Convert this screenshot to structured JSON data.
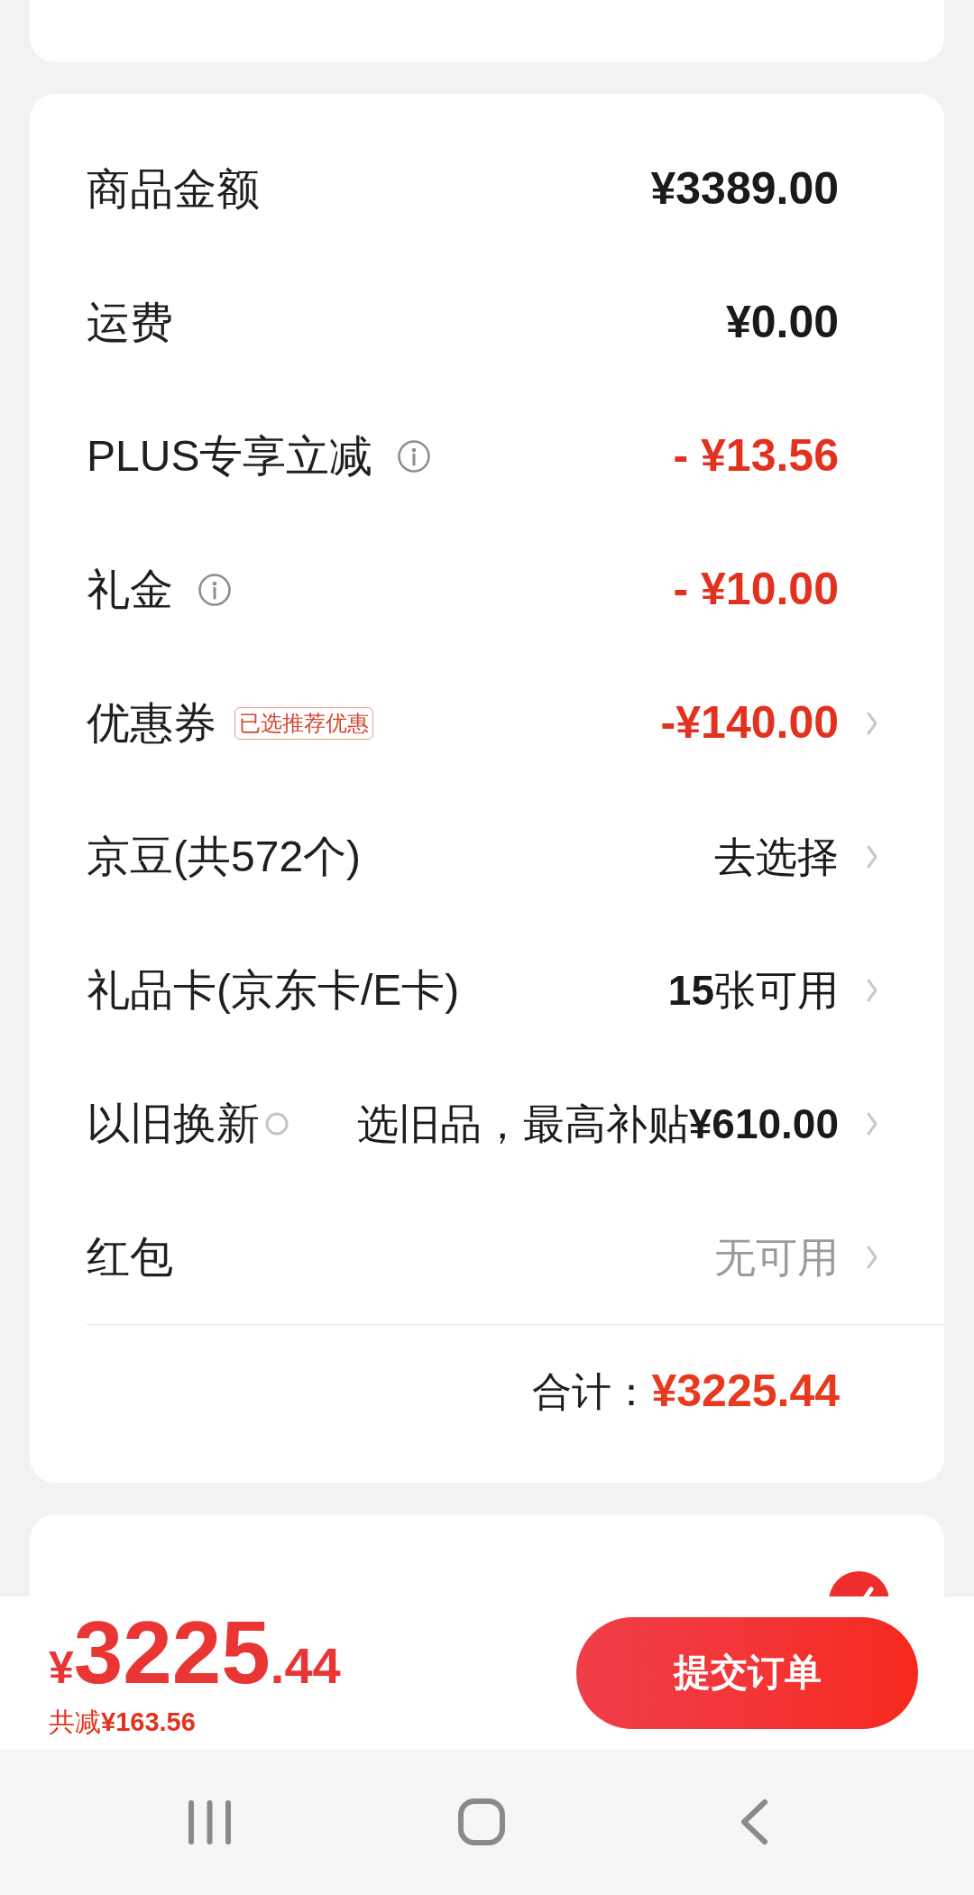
{
  "summary": {
    "rows": [
      {
        "kind": "amount",
        "label": "商品金额",
        "info": false,
        "chevron": false,
        "value": "¥3389.00"
      },
      {
        "kind": "amount",
        "label": "运费",
        "info": false,
        "chevron": false,
        "value": "¥0.00"
      },
      {
        "kind": "discount",
        "label": "PLUS专享立减",
        "info": true,
        "chevron": false,
        "value": "- ¥13.56"
      },
      {
        "kind": "discount",
        "label": "礼金",
        "info": true,
        "chevron": false,
        "value": "- ¥10.00"
      },
      {
        "kind": "discount",
        "label": "优惠券",
        "badge": "已选推荐优惠",
        "info": false,
        "chevron": true,
        "value": "-¥140.00"
      },
      {
        "kind": "select",
        "label": "京豆(共572个)",
        "info": false,
        "chevron": true,
        "value": "去选择"
      },
      {
        "kind": "select",
        "label": "礼品卡(京东卡/E卡)",
        "info": false,
        "chevron": true,
        "value": "**15**张可用"
      },
      {
        "kind": "trade_in",
        "label": "以旧换新",
        "info": false,
        "chevron": true,
        "value": "选旧品，最高补贴**¥610.00**"
      },
      {
        "kind": "unavailable",
        "label": "红包",
        "info": false,
        "chevron": true,
        "value": "无可用"
      }
    ],
    "total": {
      "label": "合计：",
      "value": "¥3225.44"
    }
  },
  "payment": {
    "selected": true
  },
  "footer": {
    "currency": "¥",
    "price_integer": "3225",
    "price_decimal": ".44",
    "savings": "共减**¥163.56**",
    "submit_button": "提交订单"
  }
}
